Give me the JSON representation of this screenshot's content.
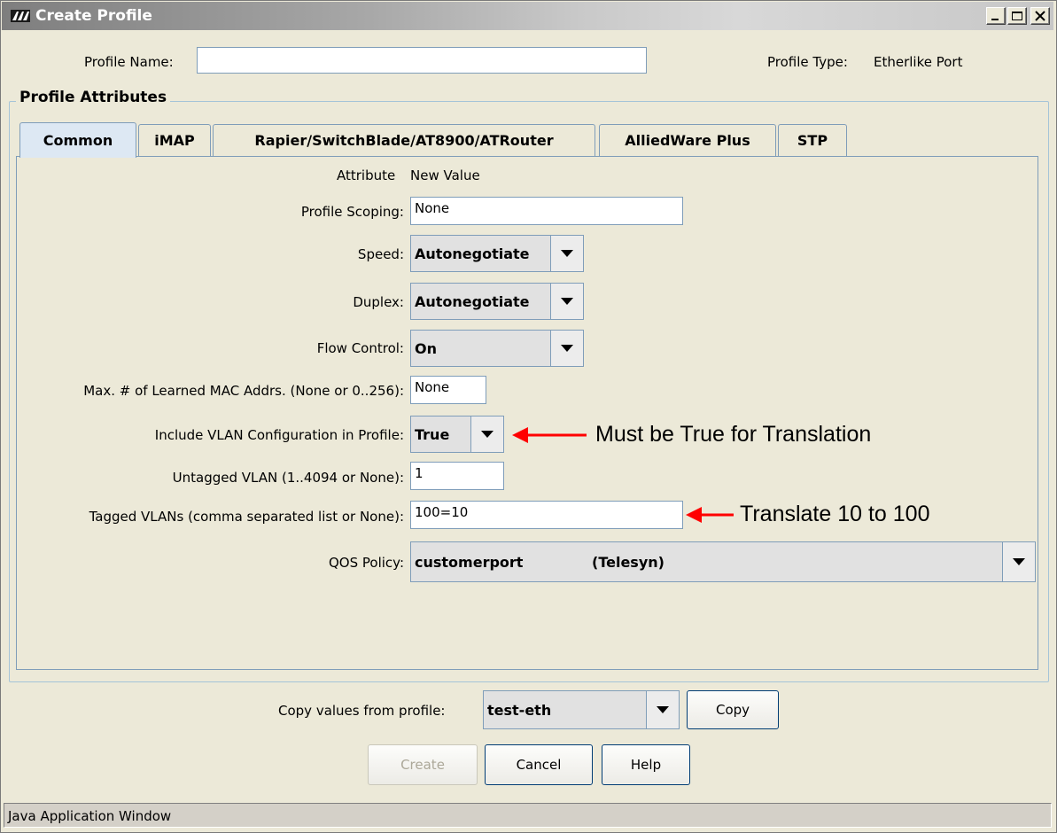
{
  "window": {
    "title": "Create Profile"
  },
  "header": {
    "profile_name_label": "Profile Name:",
    "profile_name_value": "",
    "profile_type_label": "Profile Type:",
    "profile_type_value": "Etherlike Port"
  },
  "group": {
    "title": "Profile Attributes"
  },
  "tabs": [
    {
      "label": "Common",
      "active": true
    },
    {
      "label": "iMAP",
      "active": false
    },
    {
      "label": "Rapier/SwitchBlade/AT8900/ATRouter",
      "active": false
    },
    {
      "label": "AlliedWare Plus",
      "active": false
    },
    {
      "label": "STP",
      "active": false
    }
  ],
  "form": {
    "header_attribute": "Attribute",
    "header_value": "New Value",
    "profile_scoping": {
      "label": "Profile Scoping:",
      "value": "None"
    },
    "speed": {
      "label": "Speed:",
      "value": "Autonegotiate"
    },
    "duplex": {
      "label": "Duplex:",
      "value": "Autonegotiate"
    },
    "flow_control": {
      "label": "Flow Control:",
      "value": "On"
    },
    "max_mac": {
      "label": "Max. # of Learned MAC Addrs. (None or 0..256):",
      "value": "None"
    },
    "include_vlan": {
      "label": "Include VLAN Configuration in Profile:",
      "value": "True"
    },
    "untagged_vlan": {
      "label": "Untagged VLAN (1..4094 or None):",
      "value": "1"
    },
    "tagged_vlans": {
      "label": "Tagged VLANs (comma separated list or None):",
      "value": "100=10"
    },
    "qos_policy": {
      "label": "QOS Policy:",
      "value_name": "customerport",
      "value_owner": "(Telesyn)"
    }
  },
  "annotations": {
    "vlan_note": "Must be True for Translation",
    "tagged_note": "Translate 10 to 100",
    "arrow_color": "#ff0000"
  },
  "copy": {
    "label": "Copy values from profile:",
    "value": "test-eth",
    "button": "Copy"
  },
  "buttons": {
    "create": "Create",
    "cancel": "Cancel",
    "help": "Help"
  },
  "status_bar": {
    "text": "Java Application Window"
  },
  "icons": {
    "logo": "allied-telesis-logo-icon",
    "minimize": "minimize-icon",
    "maximize": "maximize-icon",
    "close": "close-icon",
    "dropdown": "chevron-down-icon"
  }
}
